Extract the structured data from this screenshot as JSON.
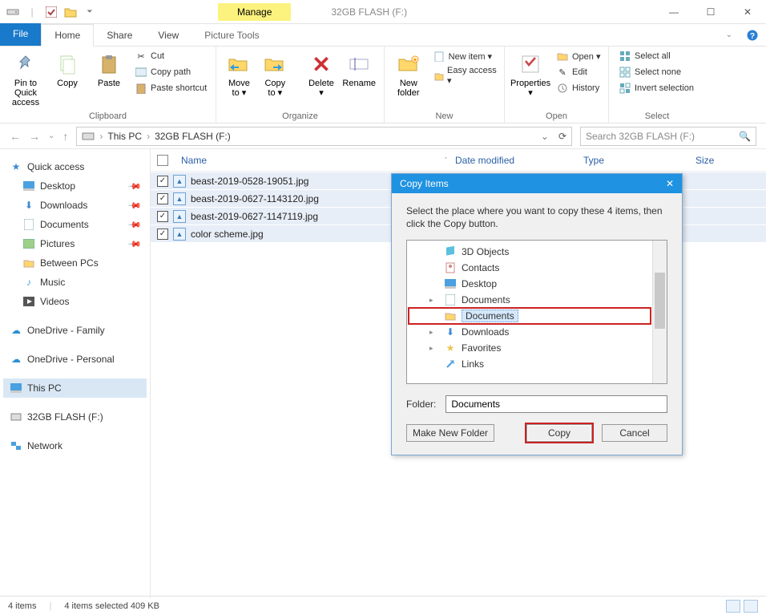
{
  "window": {
    "manage_tab": "Manage",
    "title": "32GB FLASH (F:)",
    "controls": {
      "min": "—",
      "max": "☐",
      "close": "✕"
    }
  },
  "tabs": {
    "file": "File",
    "home": "Home",
    "share": "Share",
    "view": "View",
    "picture_tools": "Picture Tools"
  },
  "ribbon": {
    "clipboard": {
      "label": "Clipboard",
      "pin": "Pin to Quick access",
      "copy": "Copy",
      "paste": "Paste",
      "cut": "Cut",
      "copy_path": "Copy path",
      "paste_shortcut": "Paste shortcut"
    },
    "organize": {
      "label": "Organize",
      "move_to": "Move to ▾",
      "copy_to": "Copy to ▾",
      "delete": "Delete ▾",
      "rename": "Rename"
    },
    "new": {
      "label": "New",
      "new_folder": "New folder",
      "new_item": "New item ▾",
      "easy_access": "Easy access ▾"
    },
    "open": {
      "label": "Open",
      "properties": "Properties ▾",
      "open": "Open ▾",
      "edit": "Edit",
      "history": "History"
    },
    "select": {
      "label": "Select",
      "select_all": "Select all",
      "select_none": "Select none",
      "invert": "Invert selection"
    }
  },
  "address": {
    "crumb1": "This PC",
    "crumb2": "32GB FLASH (F:)",
    "search_placeholder": "Search 32GB FLASH (F:)"
  },
  "columns": {
    "name": "Name",
    "date": "Date modified",
    "type": "Type",
    "size": "Size"
  },
  "files": [
    {
      "name": "beast-2019-0528-19051.jpg"
    },
    {
      "name": "beast-2019-0627-1143120.jpg"
    },
    {
      "name": "beast-2019-0627-1147119.jpg"
    },
    {
      "name": "color scheme.jpg"
    }
  ],
  "sidebar": {
    "quick_access": "Quick access",
    "items": [
      "Desktop",
      "Downloads",
      "Documents",
      "Pictures",
      "Between PCs",
      "Music",
      "Videos"
    ],
    "onedrive_family": "OneDrive - Family",
    "onedrive_personal": "OneDrive - Personal",
    "this_pc": "This PC",
    "drive": "32GB FLASH (F:)",
    "network": "Network"
  },
  "dialog": {
    "title": "Copy Items",
    "message": "Select the place where you want to copy these 4 items, then click the Copy button.",
    "tree": [
      "3D Objects",
      "Contacts",
      "Desktop",
      "Documents",
      "Documents",
      "Downloads",
      "Favorites",
      "Links"
    ],
    "folder_label": "Folder:",
    "folder_value": "Documents",
    "make_new": "Make New Folder",
    "copy": "Copy",
    "cancel": "Cancel"
  },
  "status": {
    "count": "4 items",
    "selected": "4 items selected  409 KB"
  }
}
